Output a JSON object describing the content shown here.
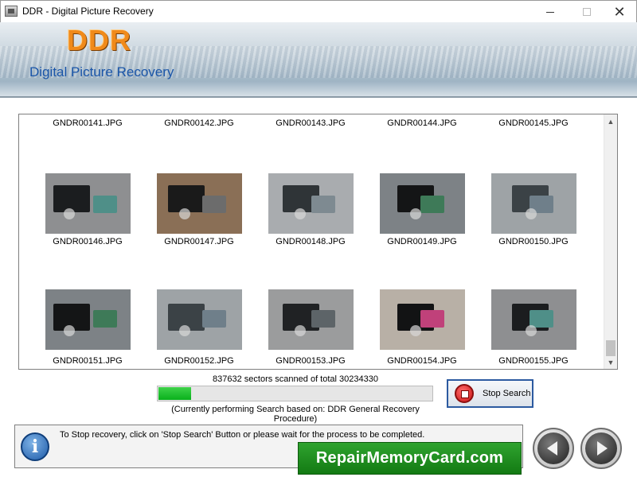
{
  "window": {
    "title": "DDR - Digital Picture Recovery",
    "close_glyph": "✕"
  },
  "banner": {
    "logo": "DDR",
    "subtitle": "Digital Picture Recovery"
  },
  "gallery": {
    "items": [
      {
        "name": "GNDR00141.JPG",
        "has_image": false
      },
      {
        "name": "GNDR00142.JPG",
        "has_image": false
      },
      {
        "name": "GNDR00143.JPG",
        "has_image": false
      },
      {
        "name": "GNDR00144.JPG",
        "has_image": false
      },
      {
        "name": "GNDR00145.JPG",
        "has_image": false
      },
      {
        "name": "GNDR00146.JPG",
        "has_image": true
      },
      {
        "name": "GNDR00147.JPG",
        "has_image": true
      },
      {
        "name": "GNDR00148.JPG",
        "has_image": true
      },
      {
        "name": "GNDR00149.JPG",
        "has_image": true
      },
      {
        "name": "GNDR00150.JPG",
        "has_image": true
      },
      {
        "name": "GNDR00151.JPG",
        "has_image": true
      },
      {
        "name": "GNDR00152.JPG",
        "has_image": true
      },
      {
        "name": "GNDR00153.JPG",
        "has_image": true
      },
      {
        "name": "GNDR00154.JPG",
        "has_image": true
      },
      {
        "name": "GNDR00155.JPG",
        "has_image": true
      }
    ]
  },
  "scan": {
    "status_text": "837632 sectors scanned of total 30234330",
    "sectors_scanned": 837632,
    "sectors_total": 30234330,
    "progress_fraction": 0.12,
    "procedure_text": "(Currently performing Search based on: DDR General Recovery Procedure)"
  },
  "stop_button": {
    "label": "Stop Search"
  },
  "footer": {
    "hint": "To Stop recovery, click on 'Stop Search' Button or please wait for the process to be completed.",
    "brand": "RepairMemoryCard.com",
    "info_glyph": "i"
  },
  "icons": {
    "scroll_up": "▲",
    "scroll_down": "▼"
  },
  "colors": {
    "logo": "#f08a1a",
    "subtitle": "#1a55a8",
    "progress": "#0fb11f",
    "brand_banner": "#1f8f1f"
  }
}
